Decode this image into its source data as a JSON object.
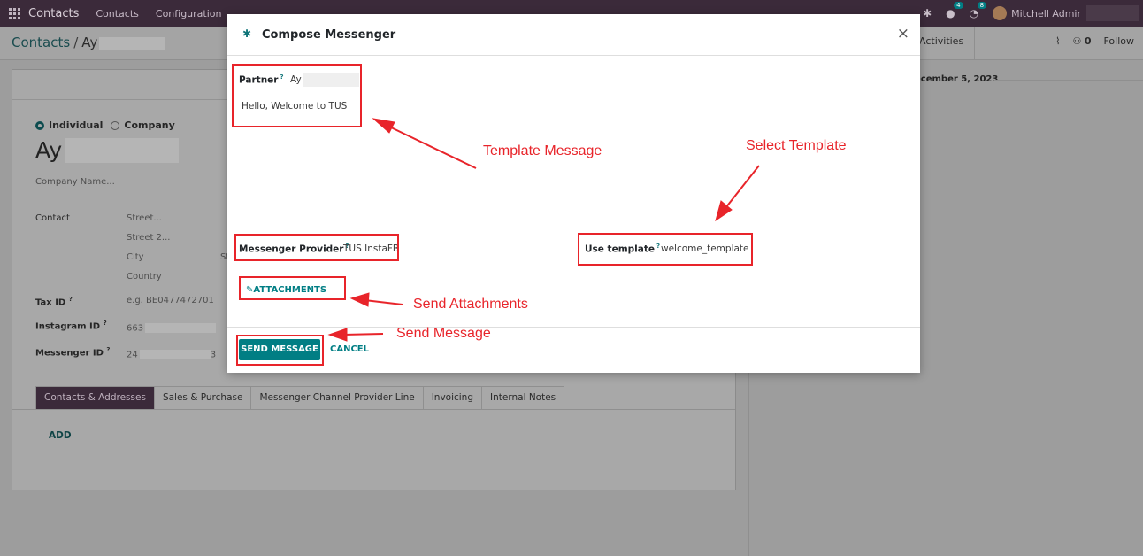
{
  "topbar": {
    "app_name": "Contacts",
    "menu": [
      "Contacts",
      "Configuration"
    ],
    "chat_badge": "4",
    "activity_badge": "8",
    "user": "Mitchell Admir"
  },
  "breadcrumb": {
    "root": "Contacts",
    "separator": "/",
    "current": "Ay"
  },
  "form": {
    "type_individual": "Individual",
    "type_company": "Company",
    "name": "Ay",
    "company_placeholder": "Company Name...",
    "contact_label": "Contact",
    "street": "Street...",
    "street2": "Street 2...",
    "city": "City",
    "city_suffix": "St",
    "country": "Country",
    "tax_label": "Tax ID",
    "tax_value": "e.g. BE0477472701",
    "instagram_label": "Instagram ID",
    "instagram_value": "663",
    "messenger_label": "Messenger ID",
    "messenger_value": "24",
    "messenger_value_end": "3",
    "tabs": [
      "Contacts & Addresses",
      "Sales & Purchase",
      "Messenger Channel Provider Line",
      "Invoicing",
      "Internal Notes"
    ],
    "add_label": "ADD"
  },
  "chatter": {
    "activities": "Activities",
    "followers_count": "0",
    "follow": "Follow",
    "date": "ecember 5, 2023"
  },
  "modal": {
    "title": "Compose Messenger",
    "close": "×",
    "partner_label": "Partner",
    "help_mark": "?",
    "partner_value": "Ay",
    "message": "Hello, Welcome to TUS",
    "provider_label": "Messenger Provider",
    "provider_value": "TUS InstaFB",
    "template_label": "Use template",
    "template_value": "welcome_template",
    "attachments": "ATTACHMENTS",
    "send": "SEND MESSAGE",
    "cancel": "CANCEL"
  },
  "annotations": {
    "template_message": "Template Message",
    "select_template": "Select Template",
    "send_attachments": "Send Attachments",
    "send_message": "Send Message",
    "color": "#e8242a"
  }
}
